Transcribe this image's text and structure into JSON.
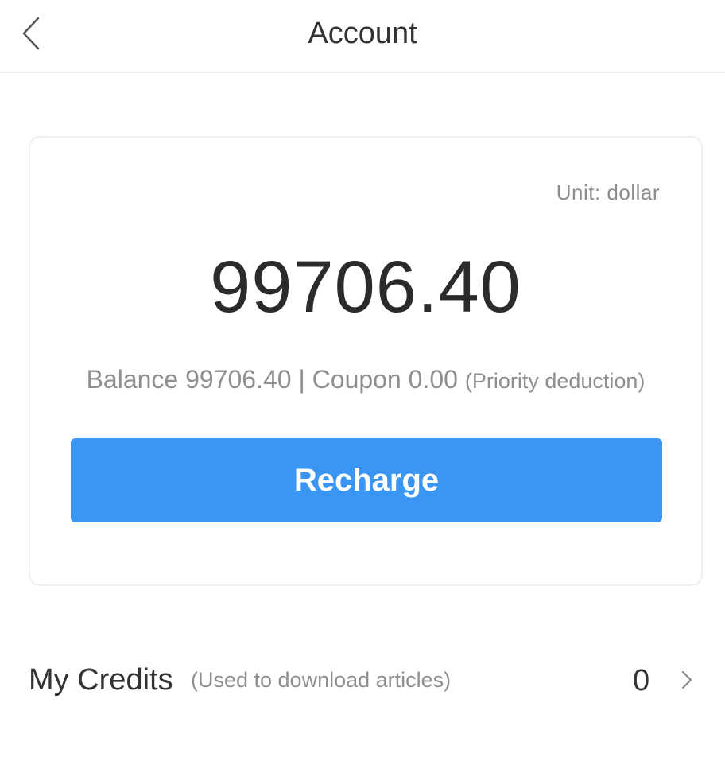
{
  "header": {
    "title": "Account",
    "back_icon": "chevron-left-icon"
  },
  "account_card": {
    "unit_label": "Unit: dollar",
    "amount": "99706.40",
    "balance_text": "Balance 99706.40 | Coupon 0.00 ",
    "balance_note": "(Priority deduction)",
    "recharge_label": "Recharge",
    "button_color": "#3a95f3"
  },
  "credits": {
    "label": "My Credits",
    "note": "(Used to download articles)",
    "value": "0",
    "arrow_icon": "chevron-right-icon"
  }
}
